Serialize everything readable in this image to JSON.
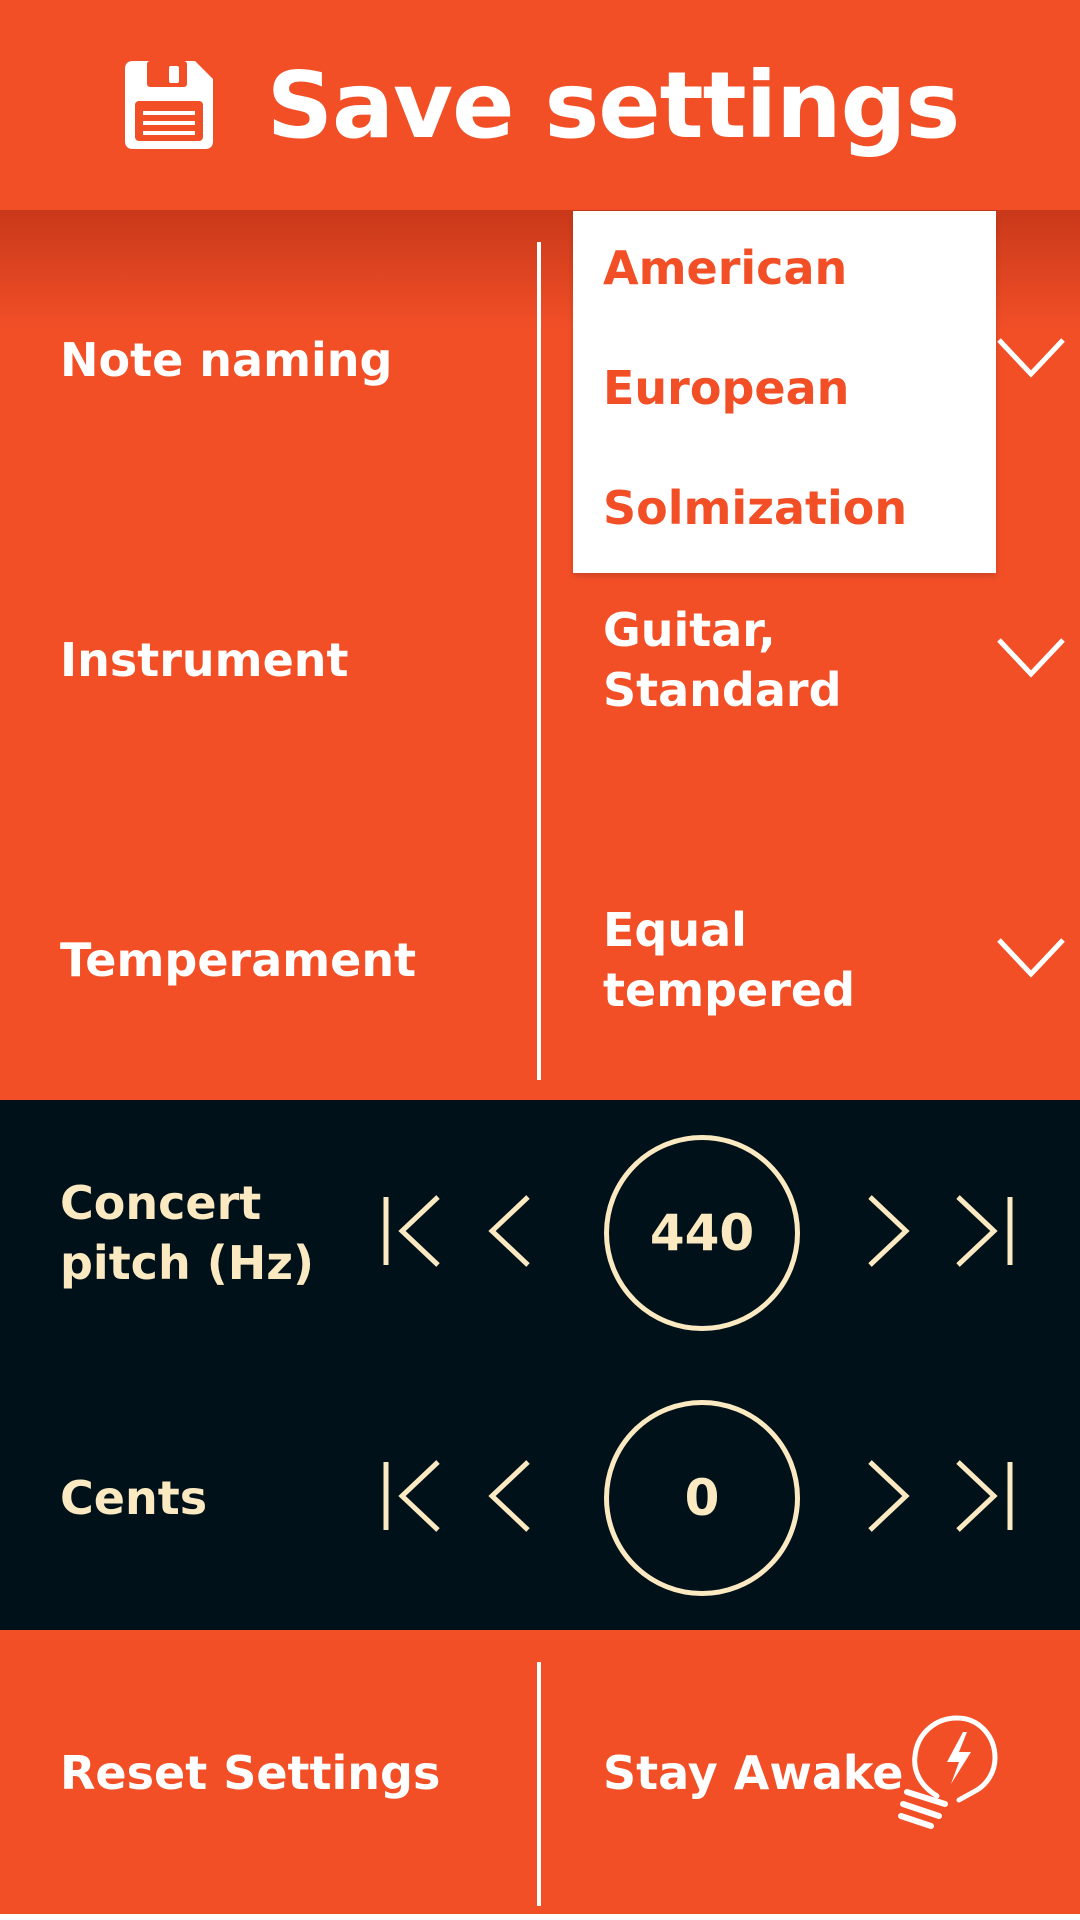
{
  "header": {
    "title": "Save settings",
    "icon": "floppy-disk-icon"
  },
  "settings": {
    "rows": [
      {
        "label": "Note naming",
        "value": "American"
      },
      {
        "label": "Instrument",
        "value_line1": "Guitar,",
        "value_line2": "Standard"
      },
      {
        "label": "Temperament",
        "value_line1": "Equal",
        "value_line2": "tempered"
      }
    ],
    "dropdown": {
      "options": [
        "American",
        "European",
        "Solmization"
      ]
    }
  },
  "steppers": [
    {
      "label_line1": "Concert",
      "label_line2": "pitch (Hz)",
      "value": "440"
    },
    {
      "label_line1": "Cents",
      "value": "0"
    }
  ],
  "bottom": {
    "reset_label": "Reset Settings",
    "awake_label": "Stay Awake",
    "awake_icon": "lightbulb-bolt-icon"
  },
  "colors": {
    "accent": "#f24f27",
    "dark": "#01111a",
    "cream": "#fbe9c1",
    "white": "#ffffff"
  }
}
